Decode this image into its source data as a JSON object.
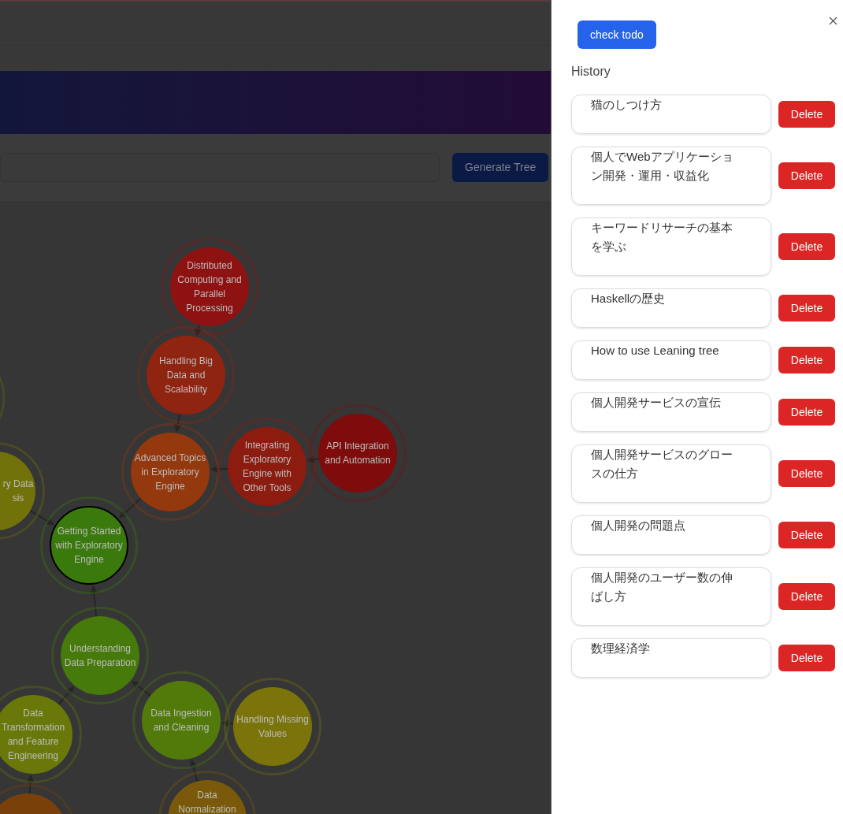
{
  "search_bar": {
    "button": "Generate Tree"
  },
  "tree": {
    "nodes": [
      {
        "label": "Distributed Computing and Parallel Processing",
        "color": "#8f1212",
        "selected": false
      },
      {
        "label": "Handling Big Data and Scalability",
        "color": "#8f2410",
        "selected": false
      },
      {
        "label": "Advanced Topics in Exploratory Engine",
        "color": "#94380e",
        "selected": false
      },
      {
        "label": "Integrating Exploratory Engine with Other Tools",
        "color": "#8c1c10",
        "selected": false
      },
      {
        "label": "API Integration and Automation",
        "color": "#7e0c0c",
        "selected": false
      },
      {
        "label": "Getting Started with Exploratory Engine",
        "color": "#3a7a0c",
        "selected": true
      },
      {
        "label": "ry Data\nsis",
        "color": "#72720a",
        "selected": false
      },
      {
        "label": "Understanding Data Preparation",
        "color": "#467a0a",
        "selected": false
      },
      {
        "label": "Data Ingestion and Cleaning",
        "color": "#527a0a",
        "selected": false
      },
      {
        "label": "Handling Missing Values",
        "color": "#7a740a",
        "selected": false
      },
      {
        "label": "Data Transformation and Feature Engineering",
        "color": "#6a780a",
        "selected": false
      },
      {
        "label": "Data Normalization",
        "color": "#7a5a0a",
        "selected": false
      },
      {
        "color": "#7a400a",
        "selected": false
      }
    ]
  },
  "drawer": {
    "button": "check todo",
    "heading": "History",
    "items": [
      {
        "text": "猫のしつけ方",
        "action": "Delete"
      },
      {
        "text": "個人でWebアプリケーション開発・運用・収益化",
        "action": "Delete"
      },
      {
        "text": "キーワードリサーチの基本を学ぶ",
        "action": "Delete"
      },
      {
        "text": "Haskellの歴史",
        "action": "Delete"
      },
      {
        "text": "How to use Leaning tree",
        "action": "Delete"
      },
      {
        "text": "個人開発サービスの宣伝",
        "action": "Delete"
      },
      {
        "text": "個人開発サービスのグロースの仕方",
        "action": "Delete"
      },
      {
        "text": "個人開発の問題点",
        "action": "Delete"
      },
      {
        "text": "個人開発のユーザー数の伸ばし方",
        "action": "Delete"
      },
      {
        "text": "数理経済学",
        "action": "Delete"
      }
    ]
  }
}
